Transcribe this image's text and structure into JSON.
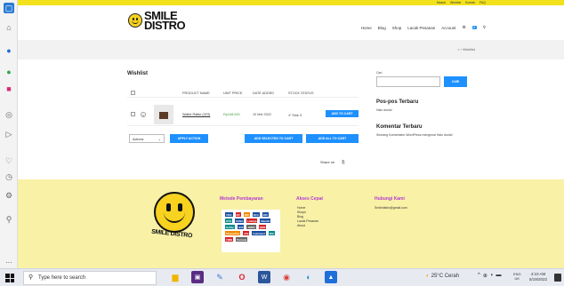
{
  "browser_sidebar": {
    "icons": [
      "edge-icon",
      "home-icon",
      "blue-app-icon",
      "green-app-icon",
      "instagram-icon",
      "circle-icon",
      "play-icon",
      "heart-icon",
      "clock-icon",
      "gear-icon",
      "pin-icon",
      "more-icon"
    ],
    "more_label": "..."
  },
  "topbar": {
    "links": [
      "Masuk",
      "Wishlist",
      "Kontak",
      "FAQ"
    ]
  },
  "header": {
    "logo_line1": "SMILE",
    "logo_line2": "DISTRO",
    "nav": [
      "Home",
      "Blog",
      "Shop",
      "Lacak Pesanan",
      "Account"
    ],
    "cart_count": "0",
    "search_glyph": "⚲"
  },
  "breadcrumb": {
    "text": "⌂ › Wishlist"
  },
  "wishlist": {
    "title": "Wishlist",
    "columns": [
      "PRODUCT NAME",
      "UNIT PRICE",
      "DATE ADDED",
      "STOCK STATUS"
    ],
    "rows": [
      {
        "remove": "×",
        "name": "Wallet Rattle (023)",
        "price": "Rp108.000",
        "date": "10 Mei 2022",
        "stock": "✔ Stok 3",
        "add_label": "ADD TO CART"
      }
    ],
    "action_select": "Actions",
    "apply_label": "APPLY ACTION",
    "add_selected_label": "ADD SELECTED TO CART",
    "add_all_label": "ADD ALL TO CART",
    "share_label": "Share on"
  },
  "widgets": {
    "search_label": "Cari",
    "search_button": "CARI",
    "posts_title": "Pos-pos Terbaru",
    "posts": [
      "Halo dunia!"
    ],
    "comments_title": "Komentar Terbaru",
    "comments": [
      "Seorang Komentator WordPress mengenai Halo dunia!"
    ]
  },
  "footer": {
    "brand": "SMILE DISTRO",
    "payment_title": "Metode Pembayaran",
    "payment_logos": [
      "VISA",
      "MC",
      "BNI",
      "BCA",
      "BRI",
      "OVO",
      "DANA",
      "LinkAja",
      "Mandiri",
      "GoPay",
      "JCB",
      "AMEX",
      "QRIS",
      "ShopeePay",
      "Alfa",
      "Indomaret",
      "BSI",
      "CIMB",
      "Permata"
    ],
    "akses_title": "Akses Cepat",
    "akses_links": [
      "Home",
      "Shops",
      "Blog",
      "Lacak Pesanan",
      "About"
    ],
    "hubungi_title": "Hubungi Kami",
    "email": "Smiledistro@gmail.com"
  },
  "taskbar": {
    "search_placeholder": "Type here to search",
    "weather": "25°C Cerah",
    "lang_line1": "ENG",
    "lang_line2": "UK",
    "time": "4:10 AM",
    "date": "5/19/2022"
  }
}
